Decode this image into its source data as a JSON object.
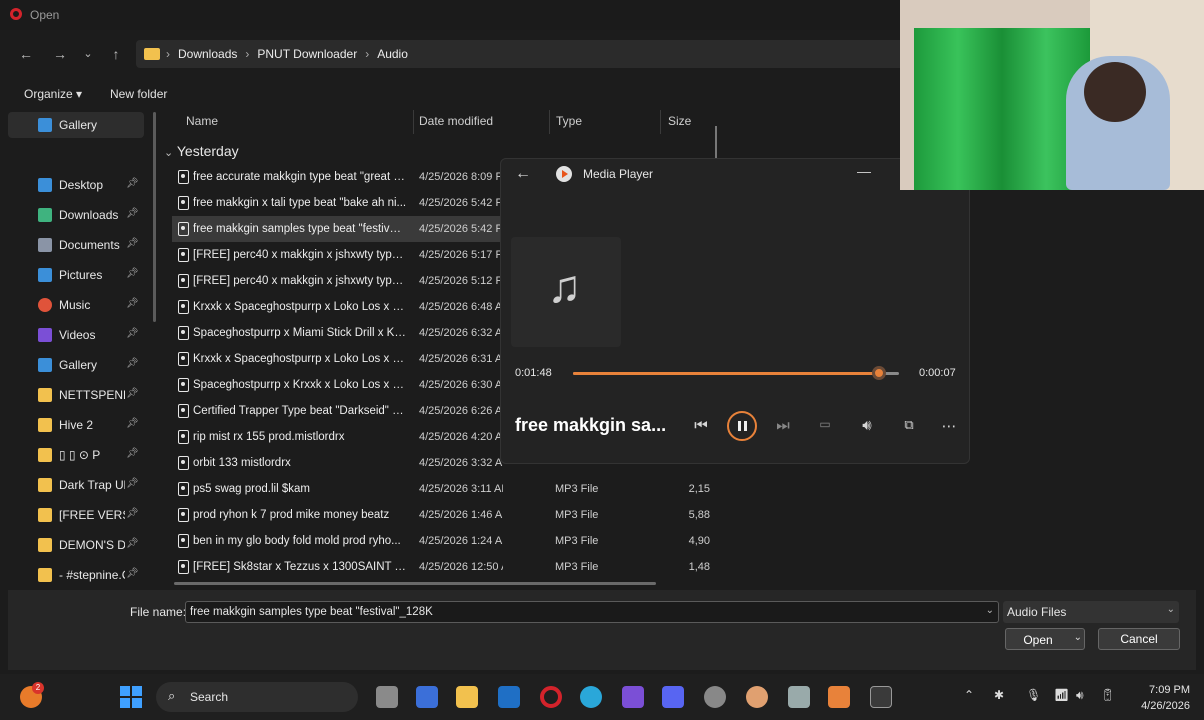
{
  "window": {
    "title": "Open"
  },
  "breadcrumb": [
    "Downloads",
    "PNUT Downloader",
    "Audio"
  ],
  "toolbar": {
    "organize": "Organize ▾",
    "new_folder": "New folder"
  },
  "sidebar": {
    "items": [
      {
        "label": "Gallery",
        "icon": "gallery-icon",
        "color": "#3b8fd9"
      },
      {
        "label": "Desktop",
        "icon": "desktop-icon",
        "color": "#3b8fd9"
      },
      {
        "label": "Downloads",
        "icon": "download-icon",
        "color": "#3fb37f"
      },
      {
        "label": "Documents",
        "icon": "documents-icon",
        "color": "#8a94a6"
      },
      {
        "label": "Pictures",
        "icon": "pictures-icon",
        "color": "#3b8fd9"
      },
      {
        "label": "Music",
        "icon": "music-icon",
        "color": "#e0533a"
      },
      {
        "label": "Videos",
        "icon": "videos-icon",
        "color": "#7b4fd6"
      },
      {
        "label": "Gallery",
        "icon": "gallery-icon",
        "color": "#3b8fd9"
      },
      {
        "label": "NETTSPEND",
        "icon": "folder-icon",
        "color": "#f2c14e"
      },
      {
        "label": "Hive 2",
        "icon": "folder-icon",
        "color": "#f2c14e"
      },
      {
        "label": "▯   ▯   ⊙ P",
        "icon": "folder-icon",
        "color": "#f2c14e"
      },
      {
        "label": "Dark Trap Ult",
        "icon": "folder-icon",
        "color": "#f2c14e"
      },
      {
        "label": "[FREE VERSIC",
        "icon": "folder-icon",
        "color": "#f2c14e"
      },
      {
        "label": "DEMON'S DF",
        "icon": "folder-icon",
        "color": "#f2c14e"
      },
      {
        "label": "- #stepnine.C",
        "icon": "folder-icon",
        "color": "#f2c14e"
      }
    ]
  },
  "columns": {
    "name": "Name",
    "date": "Date modified",
    "type": "Type",
    "size": "Size"
  },
  "group": "Yesterday",
  "files": [
    {
      "name": "free accurate makkgin type beat \"great w...",
      "date": "4/25/2026 8:09 P",
      "type": "",
      "size": ""
    },
    {
      "name": "free makkgin x tali type beat \"bake ah ni...",
      "date": "4/25/2026 5:42 P",
      "type": "",
      "size": ""
    },
    {
      "name": "free makkgin samples type beat \"festival\"...",
      "date": "4/25/2026 5:42 P",
      "type": "",
      "size": ""
    },
    {
      "name": "[FREE] perc40 x makkgin x jshxwty type b...",
      "date": "4/25/2026 5:17 P",
      "type": "",
      "size": ""
    },
    {
      "name": "[FREE] perc40 x makkgin x jshxwty type b...",
      "date": "4/25/2026 5:12 P",
      "type": "",
      "size": ""
    },
    {
      "name": "Krxxk x Spaceghostpurrp x Loko Los x BM...",
      "date": "4/25/2026 6:48 A",
      "type": "",
      "size": ""
    },
    {
      "name": "Spaceghostpurrp x Miami Stick Drill x Krx...",
      "date": "4/25/2026 6:32 A",
      "type": "",
      "size": ""
    },
    {
      "name": "Krxxk x Spaceghostpurrp x Loko Los x BM...",
      "date": "4/25/2026 6:31 A",
      "type": "",
      "size": ""
    },
    {
      "name": "Spaceghostpurrp x Krxxk x Loko Los x BM...",
      "date": "4/25/2026 6:30 A",
      "type": "",
      "size": ""
    },
    {
      "name": "Certified Trapper Type beat \"Darkseid\" (p...",
      "date": "4/25/2026 6:26 A",
      "type": "",
      "size": ""
    },
    {
      "name": "rip mist rx 155 prod.mistlordrx",
      "date": "4/25/2026 4:20 A",
      "type": "",
      "size": ""
    },
    {
      "name": "orbit 133 mistlordrx",
      "date": "4/25/2026 3:32 AM",
      "type": "",
      "size": ""
    },
    {
      "name": "ps5 swag prod.lil $kam",
      "date": "4/25/2026 3:11 AM",
      "type": "MP3 File",
      "size": "2,15"
    },
    {
      "name": "prod ryhon k 7 prod mike money beatz",
      "date": "4/25/2026 1:46 AM",
      "type": "MP3 File",
      "size": "5,88"
    },
    {
      "name": "ben in my glo body fold mold prod ryho...",
      "date": "4/25/2026 1:24 AM",
      "type": "MP3 File",
      "size": "4,90"
    },
    {
      "name": "[FREE] Sk8star x Tezzus x 1300SAINT Type ...",
      "date": "4/25/2026 12:50 AM",
      "type": "MP3 File",
      "size": "1,48"
    }
  ],
  "player": {
    "title": "Media Player",
    "current_time": "0:01:48",
    "remaining_time": "0:00:07",
    "progress": 0.94,
    "song": "free makkgin sa...",
    "accent": "#e8823a"
  },
  "footer": {
    "filename_label": "File name:",
    "filename": "free makkgin samples type beat \"festival\"_128K",
    "filter": "Audio Files",
    "open": "Open",
    "cancel": "Cancel"
  },
  "taskbar": {
    "search": "Search",
    "time": "7:09 PM",
    "date": "4/26/2026",
    "badge": "2"
  }
}
